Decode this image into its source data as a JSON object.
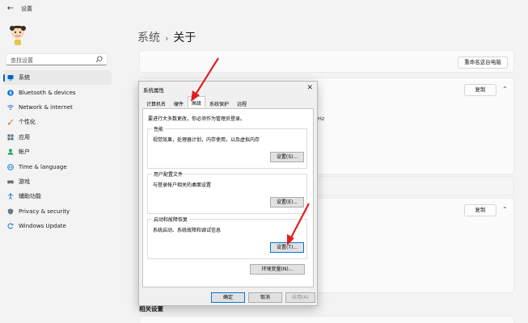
{
  "window": {
    "back_glyph": "←",
    "title": "设置"
  },
  "sidebar": {
    "search_placeholder": "查找设置",
    "items": [
      {
        "label": "系统",
        "icon": "system-icon",
        "color": "#0067c0",
        "active": true
      },
      {
        "label": "Bluetooth & devices",
        "icon": "bluetooth-icon",
        "color": "#0a74da"
      },
      {
        "label": "Network & internet",
        "icon": "network-icon",
        "color": "#2a6fd1"
      },
      {
        "label": "个性化",
        "icon": "brush-icon",
        "color": "#e0823d"
      },
      {
        "label": "应用",
        "icon": "apps-icon",
        "color": "#5a6b7b"
      },
      {
        "label": "帐户",
        "icon": "account-icon",
        "color": "#2aa564"
      },
      {
        "label": "Time & language",
        "icon": "globe-icon",
        "color": "#1f80d5"
      },
      {
        "label": "游戏",
        "icon": "gamepad-icon",
        "color": "#6b6b6b"
      },
      {
        "label": "辅助功能",
        "icon": "accessibility-icon",
        "color": "#1a72c9"
      },
      {
        "label": "Privacy & security",
        "icon": "shield-icon",
        "color": "#687785"
      },
      {
        "label": "Windows Update",
        "icon": "update-icon",
        "color": "#0a74da"
      }
    ]
  },
  "main": {
    "breadcrumb_parent": "系统",
    "breadcrumb_sep": "›",
    "breadcrumb_current": "关于",
    "rename_button": "重命名这台电脑",
    "copy_button_1": "复制",
    "copy_button_2": "复制",
    "partial_hz": "Hz",
    "related_heading": "相关设置"
  },
  "dialog": {
    "title": "系统属性",
    "close_glyph": "✕",
    "tabs": [
      "计算机名",
      "硬件",
      "高级",
      "系统保护",
      "远程"
    ],
    "active_tab": 2,
    "admin_note": "要进行大多数更改，你必须作为管理员登录。",
    "performance": {
      "label": "性能",
      "desc": "视觉效果，处理器计划，内存使用，以及虚拟内存",
      "button": "设置(S)..."
    },
    "user_profiles": {
      "label": "用户配置文件",
      "desc": "与登录帐户相关的桌面设置",
      "button": "设置(E)..."
    },
    "startup": {
      "label": "启动和故障恢复",
      "desc": "系统启动、系统故障和调试信息",
      "button": "设置(T)..."
    },
    "env_button": "环境变量(N)...",
    "ok_button": "确定",
    "cancel_button": "取消",
    "apply_button": "应用(A)"
  },
  "colors": {
    "accent": "#0067c0",
    "arrow": "#e02020"
  }
}
